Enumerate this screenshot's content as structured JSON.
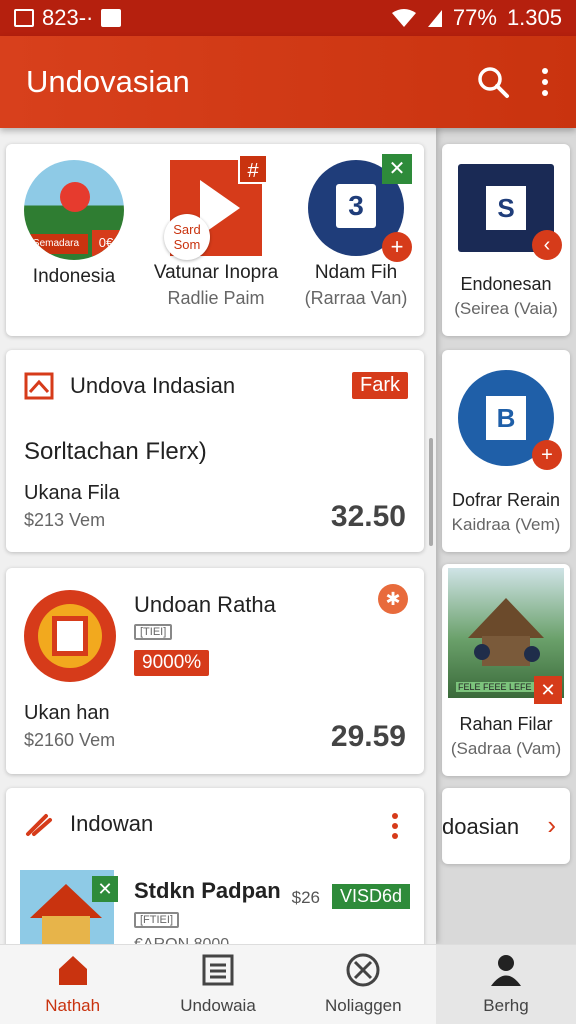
{
  "status_bar": {
    "time": "823-·",
    "battery": "77%",
    "clock": "1.305"
  },
  "app_bar": {
    "title": "Undovasian"
  },
  "apps_row": [
    {
      "name": "Indonesia",
      "thumb_text": "Semadara",
      "thumb_badge": "0€"
    },
    {
      "name": "Vatunar Inopra",
      "sub": "Radlie Paim",
      "thumb_text": "Sard Som"
    },
    {
      "name": "Ndam Fih",
      "sub": "(Rarraa Van)"
    }
  ],
  "card1": {
    "header": "Undova Indasian",
    "tag": "Fark",
    "title": "Sorltachan Flerx)",
    "subtitle": "Ukana Fila",
    "meta": "$213 Vem",
    "price": "32.50"
  },
  "card2": {
    "title": "Undoan Ratha",
    "mini_badge": "[TIEI]",
    "discount": "9000%",
    "subtitle": "Ukan han",
    "meta": "$2160 Vem",
    "price": "29.59"
  },
  "card3": {
    "header": "Indowan",
    "title": "Stdkn Padpan",
    "mini_badge": "[FTIEI]",
    "meta": "€ARON 8000",
    "price_small": "$26",
    "tag": "VISD6d"
  },
  "side": {
    "items": [
      {
        "name": "Endonesan",
        "sub": "(Seirea (Vaia)"
      },
      {
        "name": "Dofrar Rerain",
        "sub": "Kaidraa (Vem)"
      },
      {
        "name": "Rahan Filar",
        "sub": "(Sadraa (Vam)",
        "photo_caption": "FELE FEEE LEFE"
      }
    ],
    "link": "doasian"
  },
  "bottom_nav": [
    {
      "label": "Nathah",
      "icon": "home-icon"
    },
    {
      "label": "Undowaia",
      "icon": "list-icon"
    },
    {
      "label": "Noliaggen",
      "icon": "close-circle-icon"
    },
    {
      "label": "Berhg",
      "icon": "person-icon"
    }
  ],
  "colors": {
    "brand": "#c9330f",
    "accent": "#d63b1a",
    "green": "#2e8b3a",
    "navy": "#1f3d7a"
  }
}
